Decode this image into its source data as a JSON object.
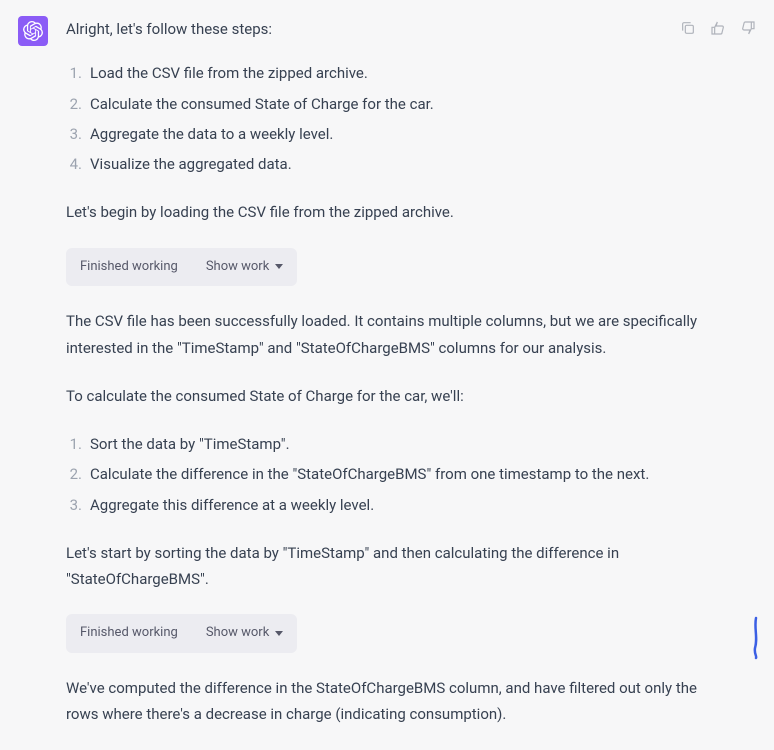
{
  "message": {
    "intro": "Alright, let's follow these steps:",
    "steps1": [
      "Load the CSV file from the zipped archive.",
      "Calculate the consumed State of Charge for the car.",
      "Aggregate the data to a weekly level.",
      "Visualize the aggregated data."
    ],
    "begin": "Let's begin by loading the CSV file from the zipped archive.",
    "chip1": {
      "status": "Finished working",
      "toggle": "Show work"
    },
    "loaded": "The CSV file has been successfully loaded. It contains multiple columns, but we are specifically interested in the \"TimeStamp\" and \"StateOfChargeBMS\" columns for our analysis.",
    "calc_intro": "To calculate the consumed State of Charge for the car, we'll:",
    "steps2": [
      "Sort the data by \"TimeStamp\".",
      "Calculate the difference in the \"StateOfChargeBMS\" from one timestamp to the next.",
      "Aggregate this difference at a weekly level."
    ],
    "start_sort": "Let's start by sorting the data by \"TimeStamp\" and then calculating the difference in \"StateOfChargeBMS\".",
    "chip2": {
      "status": "Finished working",
      "toggle": "Show work"
    },
    "computed": "We've computed the difference in the StateOfChargeBMS column, and have filtered out only the rows where there's a decrease in charge (indicating consumption)."
  }
}
